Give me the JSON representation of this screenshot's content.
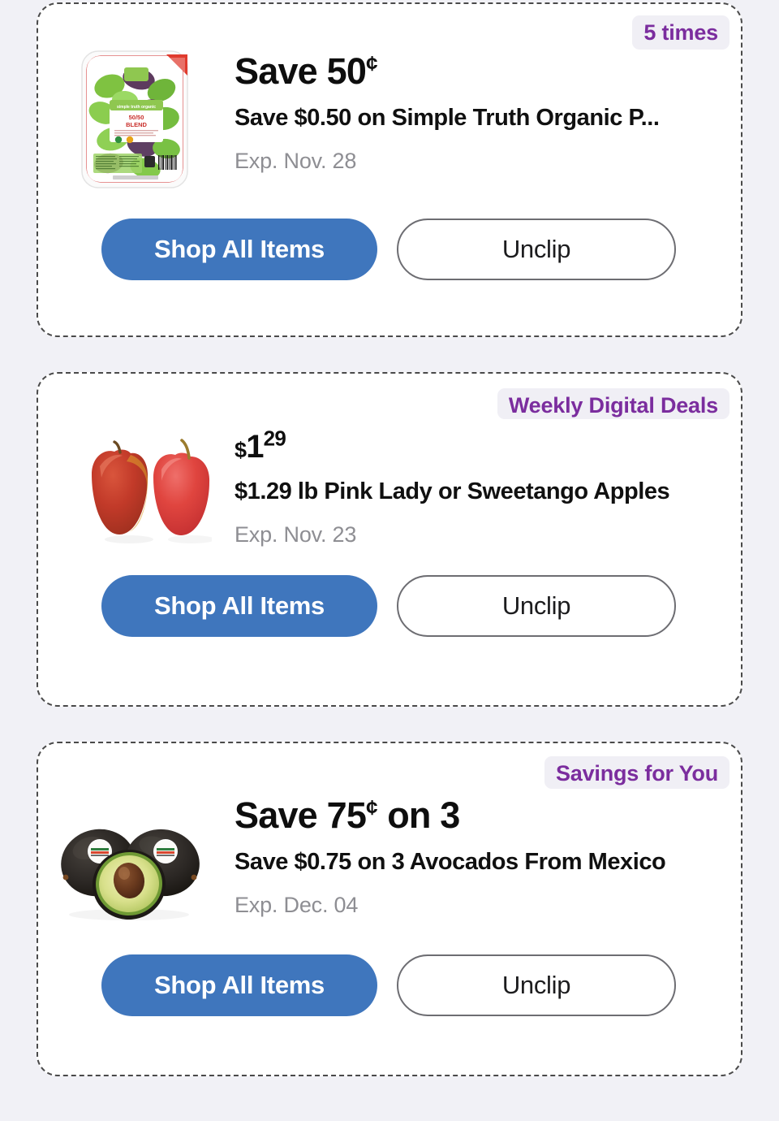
{
  "page": {
    "background_color": "#f1f1f6",
    "card_background": "#ffffff",
    "accent_blue": "#3f76bd",
    "badge_text_color": "#7b2d9e",
    "badge_background": "#f0eff5",
    "expiry_text_color": "#8e8e93"
  },
  "coupons": [
    {
      "badge": "5 times",
      "headline_prefix": "Save 50",
      "headline_symbol": "¢",
      "headline_suffix": "",
      "price_dollar": "",
      "price_whole": "",
      "price_frac": "",
      "description": "Save $0.50 on Simple Truth Organic P...",
      "expiry": "Exp. Nov. 28",
      "primary_button": "Shop All Items",
      "secondary_button": "Unclip",
      "image": "salad-greens-package"
    },
    {
      "badge": "Weekly Digital Deals",
      "headline_prefix": "",
      "headline_symbol": "",
      "headline_suffix": "",
      "price_dollar": "$",
      "price_whole": "1",
      "price_frac": "29",
      "description": "$1.29 lb Pink Lady or Sweetango Apples",
      "expiry": "Exp. Nov. 23",
      "primary_button": "Shop All Items",
      "secondary_button": "Unclip",
      "image": "two-apples"
    },
    {
      "badge": "Savings for You",
      "headline_prefix": "Save 75",
      "headline_symbol": "¢",
      "headline_suffix": " on 3",
      "price_dollar": "",
      "price_whole": "",
      "price_frac": "",
      "description": "Save $0.75 on 3 Avocados From Mexico",
      "expiry": "Exp. Dec. 04",
      "primary_button": "Shop All Items",
      "secondary_button": "Unclip",
      "image": "avocados"
    }
  ]
}
